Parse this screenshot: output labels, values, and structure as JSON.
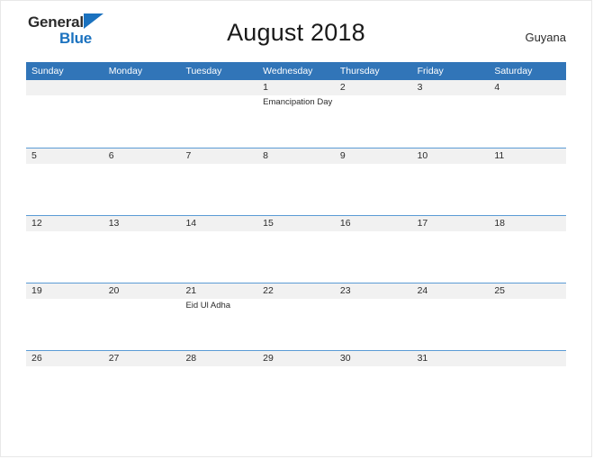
{
  "logo": {
    "word_one": "General",
    "word_two": "Blue",
    "triangle_icon": "logo-triangle-icon",
    "brand_blue": "#1b72bf"
  },
  "header": {
    "title": "August 2018",
    "country": "Guyana"
  },
  "colors": {
    "header_blue": "#3175b8",
    "row_rule_blue": "#5b9bd5",
    "date_band_gray": "#f1f1f1"
  },
  "calendar": {
    "weekdays": [
      "Sunday",
      "Monday",
      "Tuesday",
      "Wednesday",
      "Thursday",
      "Friday",
      "Saturday"
    ],
    "weeks": [
      [
        {
          "day": "",
          "event": ""
        },
        {
          "day": "",
          "event": ""
        },
        {
          "day": "",
          "event": ""
        },
        {
          "day": "1",
          "event": "Emancipation Day"
        },
        {
          "day": "2",
          "event": ""
        },
        {
          "day": "3",
          "event": ""
        },
        {
          "day": "4",
          "event": ""
        }
      ],
      [
        {
          "day": "5",
          "event": ""
        },
        {
          "day": "6",
          "event": ""
        },
        {
          "day": "7",
          "event": ""
        },
        {
          "day": "8",
          "event": ""
        },
        {
          "day": "9",
          "event": ""
        },
        {
          "day": "10",
          "event": ""
        },
        {
          "day": "11",
          "event": ""
        }
      ],
      [
        {
          "day": "12",
          "event": ""
        },
        {
          "day": "13",
          "event": ""
        },
        {
          "day": "14",
          "event": ""
        },
        {
          "day": "15",
          "event": ""
        },
        {
          "day": "16",
          "event": ""
        },
        {
          "day": "17",
          "event": ""
        },
        {
          "day": "18",
          "event": ""
        }
      ],
      [
        {
          "day": "19",
          "event": ""
        },
        {
          "day": "20",
          "event": ""
        },
        {
          "day": "21",
          "event": "Eid Ul Adha"
        },
        {
          "day": "22",
          "event": ""
        },
        {
          "day": "23",
          "event": ""
        },
        {
          "day": "24",
          "event": ""
        },
        {
          "day": "25",
          "event": ""
        }
      ],
      [
        {
          "day": "26",
          "event": ""
        },
        {
          "day": "27",
          "event": ""
        },
        {
          "day": "28",
          "event": ""
        },
        {
          "day": "29",
          "event": ""
        },
        {
          "day": "30",
          "event": ""
        },
        {
          "day": "31",
          "event": ""
        },
        {
          "day": "",
          "event": ""
        }
      ]
    ]
  }
}
